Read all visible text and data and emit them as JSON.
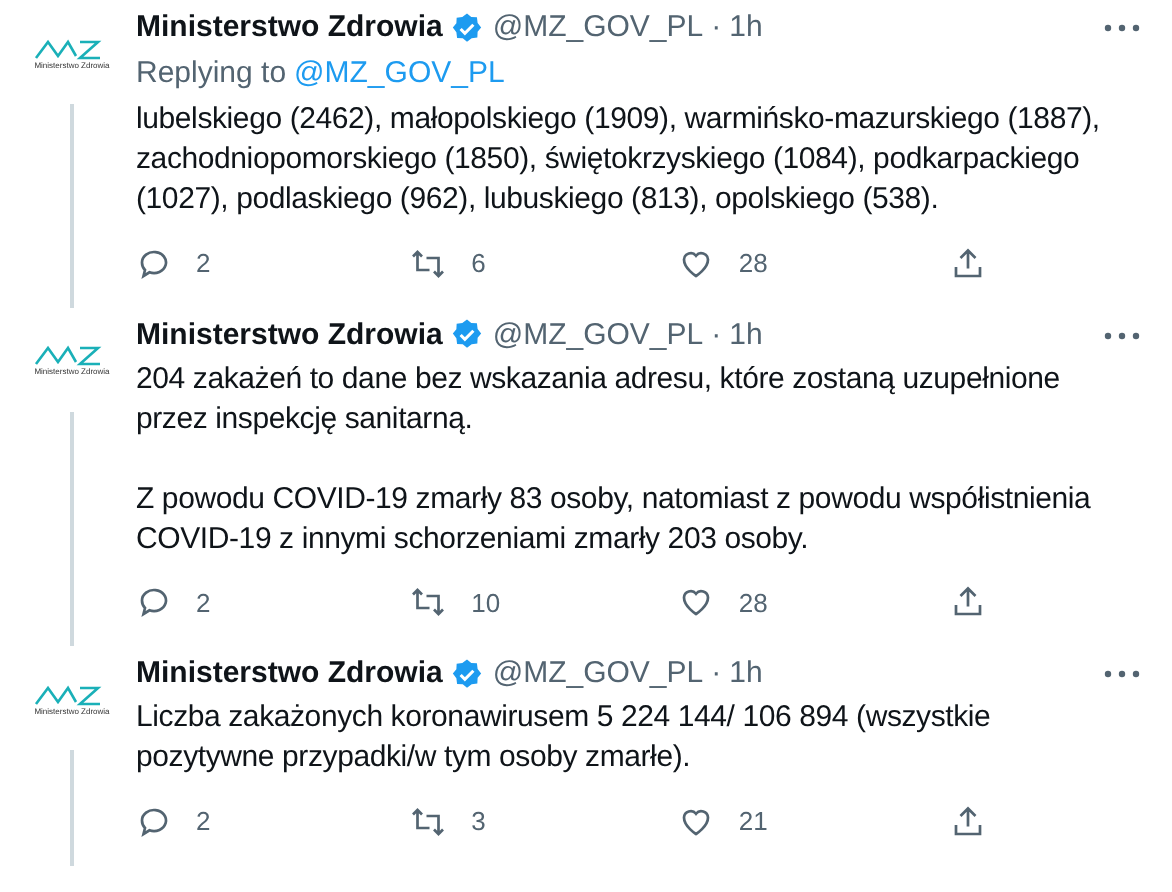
{
  "tweets": [
    {
      "avatar_caption": "Ministerstwo Zdrowia",
      "name": "Ministerstwo Zdrowia",
      "verified": true,
      "handle": "@MZ_GOV_PL",
      "separator": "·",
      "time": "1h",
      "replying_label": "Replying to",
      "replying_to": "@MZ_GOV_PL",
      "paragraphs": [
        "lubelskiego (2462), małopolskiego (1909), warmińsko-mazurskiego (1887), zachodniopomorskiego (1850), świętokrzyskiego (1084), podkarpackiego (1027), podlaskiego (962), lubuskiego (813), opolskiego (538)."
      ],
      "replies": "2",
      "retweets": "6",
      "likes": "28"
    },
    {
      "avatar_caption": "Ministerstwo Zdrowia",
      "name": "Ministerstwo Zdrowia",
      "verified": true,
      "handle": "@MZ_GOV_PL",
      "separator": "·",
      "time": "1h",
      "paragraphs": [
        "204 zakażeń to dane bez wskazania adresu, które zostaną uzupełnione przez inspekcję sanitarną.",
        "Z powodu COVID-19 zmarły 83 osoby, natomiast z powodu współistnienia COVID-19 z innymi schorzeniami zmarły 203 osoby."
      ],
      "replies": "2",
      "retweets": "10",
      "likes": "28"
    },
    {
      "avatar_caption": "Ministerstwo Zdrowia",
      "name": "Ministerstwo Zdrowia",
      "verified": true,
      "handle": "@MZ_GOV_PL",
      "separator": "·",
      "time": "1h",
      "paragraphs": [
        "Liczba zakażonych koronawirusem 5 224 144/ 106 894 (wszystkie pozytywne przypadki/w tym osoby zmarłe)."
      ],
      "replies": "2",
      "retweets": "3",
      "likes": "21"
    }
  ]
}
